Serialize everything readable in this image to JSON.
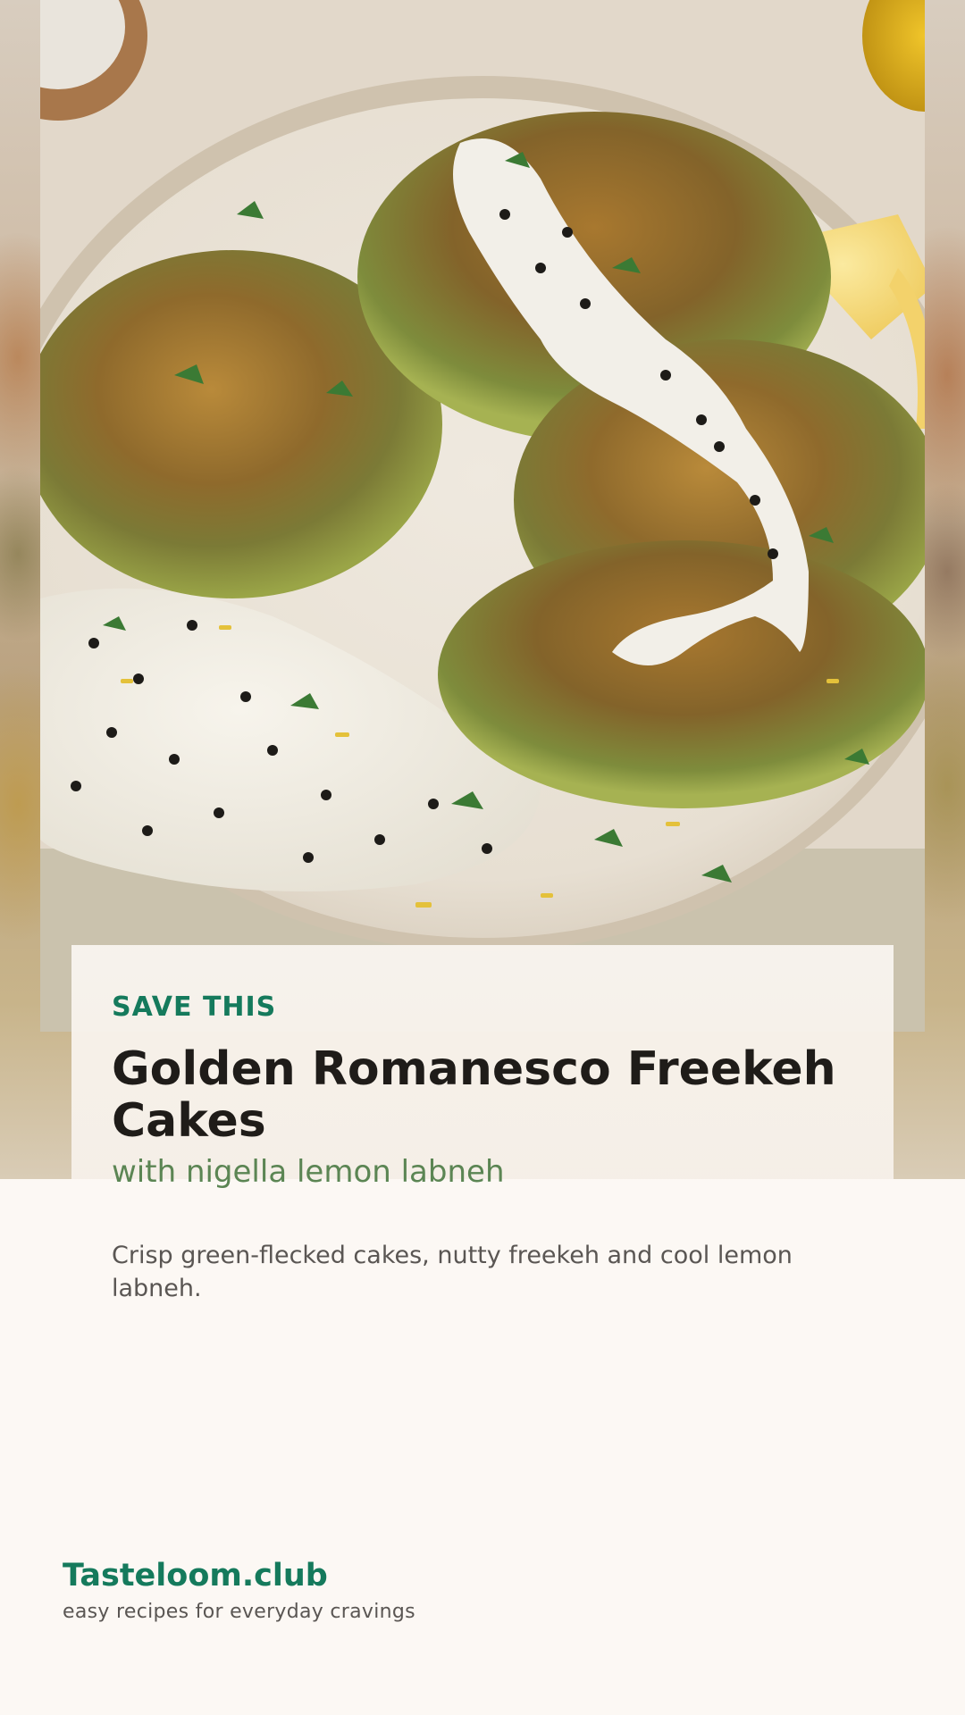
{
  "hero": {
    "image_alt": "Golden romanesco freekeh cakes on a plate with nigella lemon labneh, lemon wedges and parsley",
    "icons": {
      "photo": "food-photo-icon"
    }
  },
  "card": {
    "eyebrow": "SAVE THIS",
    "title": "Golden Romanesco Freekeh Cakes",
    "subtitle": "with nigella lemon labneh",
    "description": "Crisp green-flecked cakes, nutty freekeh and cool lemon labneh."
  },
  "footer": {
    "brand": "Tasteloom.club",
    "tagline": "easy recipes for everyday cravings"
  },
  "colors": {
    "accent": "#157a5c",
    "subtitle": "#5b8553",
    "title": "#1f1c19",
    "body_text": "#5a5653",
    "page_background": "#fcf8f4"
  }
}
